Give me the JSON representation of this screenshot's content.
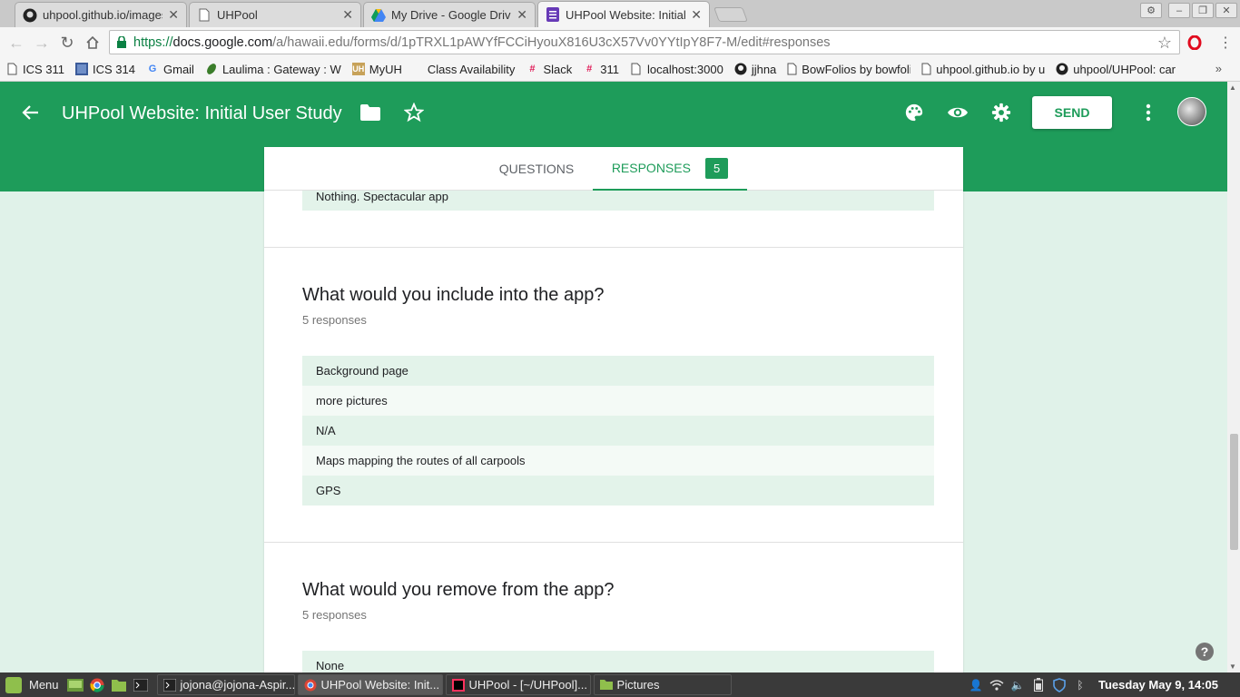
{
  "browser": {
    "tabs": [
      {
        "title": "uhpool.github.io/images",
        "icon": "github-icon",
        "active": false
      },
      {
        "title": "UHPool",
        "icon": "page-icon",
        "active": false
      },
      {
        "title": "My Drive - Google Drive",
        "icon": "google-drive-icon",
        "active": false
      },
      {
        "title": "UHPool Website: Initial",
        "icon": "google-forms-icon",
        "active": true
      }
    ],
    "url": {
      "scheme": "https://",
      "host": "docs.google.com",
      "path": "/a/hawaii.edu/forms/d/1pTRXL1pAWYfFCCiHyouX816U3cX57Vv0YYtIpY8F7-M/edit#responses"
    },
    "bookmarks": [
      {
        "label": "ICS 311",
        "icon": "page-icon"
      },
      {
        "label": "ICS 314",
        "icon": "square-icon"
      },
      {
        "label": "Gmail",
        "icon": "google-icon"
      },
      {
        "label": "Laulima : Gateway : W",
        "icon": "leaf-icon"
      },
      {
        "label": "MyUH",
        "icon": "uh-icon"
      },
      {
        "label": "Class Availability",
        "icon": "blank-icon"
      },
      {
        "label": "Slack",
        "icon": "slack-icon"
      },
      {
        "label": "311",
        "icon": "slack-icon"
      },
      {
        "label": "localhost:3000",
        "icon": "page-icon"
      },
      {
        "label": "jjhna",
        "icon": "github-icon"
      },
      {
        "label": "BowFolios by bowfoli",
        "icon": "page-icon"
      },
      {
        "label": "uhpool.github.io by u",
        "icon": "page-icon"
      },
      {
        "label": "uhpool/UHPool: car p",
        "icon": "github-icon"
      }
    ],
    "bookmarks_overflow": "»"
  },
  "form": {
    "title": "UHPool Website: Initial User Study",
    "send_label": "SEND",
    "tab_questions": "QUESTIONS",
    "tab_responses": "RESPONSES",
    "response_count": "5",
    "prev_answer_tail": "Nothing. Spectacular app",
    "questions": [
      {
        "title": "What would you include into the app?",
        "count_label": "5 responses",
        "answers": [
          "Background page",
          "more pictures",
          "N/A",
          "Maps mapping the routes of all carpools",
          "GPS"
        ]
      },
      {
        "title": "What would you remove from the app?",
        "count_label": "5 responses",
        "answers": [
          "None"
        ]
      }
    ]
  },
  "help_label": "?",
  "taskbar": {
    "menu_label": "Menu",
    "windows": [
      {
        "title": "jojona@jojona-Aspir...",
        "icon": "terminal-icon",
        "active": false
      },
      {
        "title": "UHPool Website: Init...",
        "icon": "chrome-icon",
        "active": true
      },
      {
        "title": "UHPool - [~/UHPool]...",
        "icon": "intellij-icon",
        "active": false
      },
      {
        "title": "Pictures",
        "icon": "folder-icon",
        "active": false
      }
    ],
    "clock": "Tuesday May  9, 14:05"
  },
  "colors": {
    "brand_green": "#1e9c5a",
    "page_bg": "#e0f2e9",
    "row_even": "#e3f3ea",
    "row_odd": "#f4faf6"
  }
}
